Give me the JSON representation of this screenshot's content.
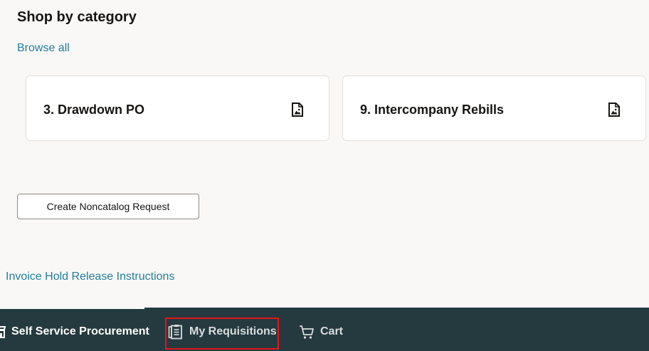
{
  "shop": {
    "title": "Shop by category",
    "browse_all": "Browse all"
  },
  "categories": [
    {
      "label": "3. Drawdown PO",
      "icon": "image-file-icon"
    },
    {
      "label": "9. Intercompany Rebills",
      "icon": "image-file-icon"
    }
  ],
  "actions": {
    "noncatalog_label": "Create Noncatalog Request"
  },
  "links": {
    "invoice_hold": "Invoice Hold Release Instructions"
  },
  "nav": {
    "home_label": "Self Service Procurement",
    "requisitions_label": "My Requisitions",
    "cart_label": "Cart"
  },
  "colors": {
    "link": "#227e9e",
    "nav_background": "#253a3f",
    "highlight": "#e5141b",
    "page_background": "#f9f8f6"
  }
}
